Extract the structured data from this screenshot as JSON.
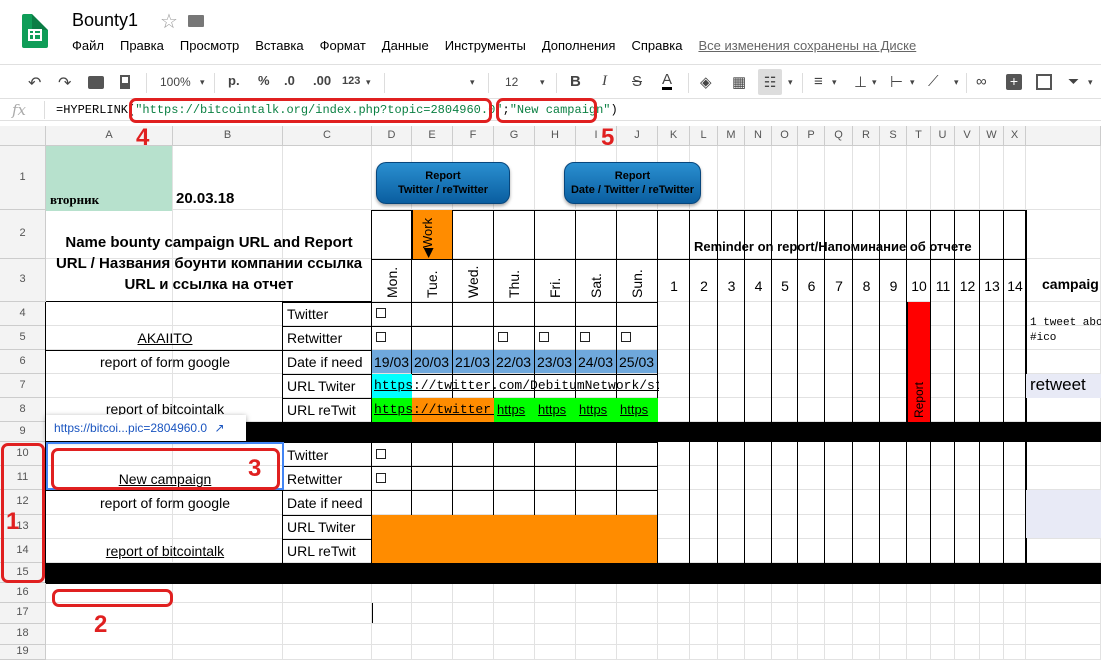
{
  "header": {
    "doc_title": "Bounty1",
    "menu": [
      "Файл",
      "Правка",
      "Просмотр",
      "Вставка",
      "Формат",
      "Данные",
      "Инструменты",
      "Дополнения",
      "Справка"
    ],
    "saved_status": "Все изменения сохранены на Диске"
  },
  "toolbar": {
    "zoom": "100%",
    "currency": "р.",
    "percent": "%",
    "decimals_less": ".0",
    "decimals_more": ".00",
    "format_more": "123",
    "font_size": "12",
    "bold": "B",
    "italic": "I",
    "strike": "S",
    "text_color": "A"
  },
  "formula_bar": {
    "fx": "fx",
    "prefix": "=HYPERLINK(",
    "url": "\"https://bitcointalk.org/index.php?topic=2804960.0\"",
    "sep": ";",
    "label": "\"New campaign\"",
    "suffix": ")"
  },
  "columns": [
    "A",
    "B",
    "C",
    "D",
    "E",
    "F",
    "G",
    "H",
    "I",
    "J",
    "K",
    "L",
    "M",
    "N",
    "O",
    "P",
    "Q",
    "R",
    "S",
    "T",
    "U",
    "V",
    "W",
    "X"
  ],
  "rows": [
    "1",
    "2",
    "3",
    "4",
    "5",
    "6",
    "7",
    "8",
    "9",
    "10",
    "11",
    "12",
    "13",
    "14",
    "15",
    "16",
    "17",
    "18",
    "19"
  ],
  "sheet": {
    "day_label": "вторник",
    "date": "20.03.18",
    "btn_report1": "Report\nTwitter / reTwitter",
    "btn_report2": "Report\nDate / Twitter / reTwitter",
    "title": "Name bounty campaign URL and Report URL / Названия боунти компании ссылка URL и ссылка на отчет",
    "reminder": "Reminder on report/Напоминание об отчете",
    "work_label": "Work",
    "days": [
      "Mon.",
      "Tue.",
      "Wed.",
      "Thu.",
      "Fri.",
      "Sat.",
      "Sun."
    ],
    "reminder_numbers": [
      "1",
      "2",
      "3",
      "4",
      "5",
      "6",
      "7",
      "8",
      "9",
      "10",
      "11",
      "12",
      "13",
      "14"
    ],
    "campaign_header": "campaig",
    "akaiito": "AKAIITO",
    "report_form_google": "report of form google",
    "report_bitcointalk": "report of bitcointalk",
    "new_campaign": "New campaign",
    "row_labels": [
      "Twitter",
      "Retwitter",
      "Date if need",
      "URL Twiter",
      "URL reTwit"
    ],
    "dates": [
      "19/03",
      "20/03",
      "21/03",
      "22/03",
      "23/03",
      "24/03",
      "25/03"
    ],
    "url_twitter": "https://twitter.com/DebitumNetwork/statu",
    "url_retwit": "https://twitter.c",
    "url_short": "https",
    "report_vertical": "Report",
    "tweet_note": "1 tweet abo",
    "tweet_hash": "#ico",
    "retweet": "retweet",
    "tooltip_link": "https://bitcoi...pic=2804960.0"
  },
  "annotations": [
    "1",
    "2",
    "3",
    "4",
    "5"
  ],
  "colors": {
    "green_cell": "#b7e1cd",
    "date_blue": "#6fa8dc",
    "orange": "#ff8c00",
    "cyan": "#00ffff",
    "green": "#00ff00",
    "red": "#ff0000",
    "annotation": "#e02020"
  }
}
